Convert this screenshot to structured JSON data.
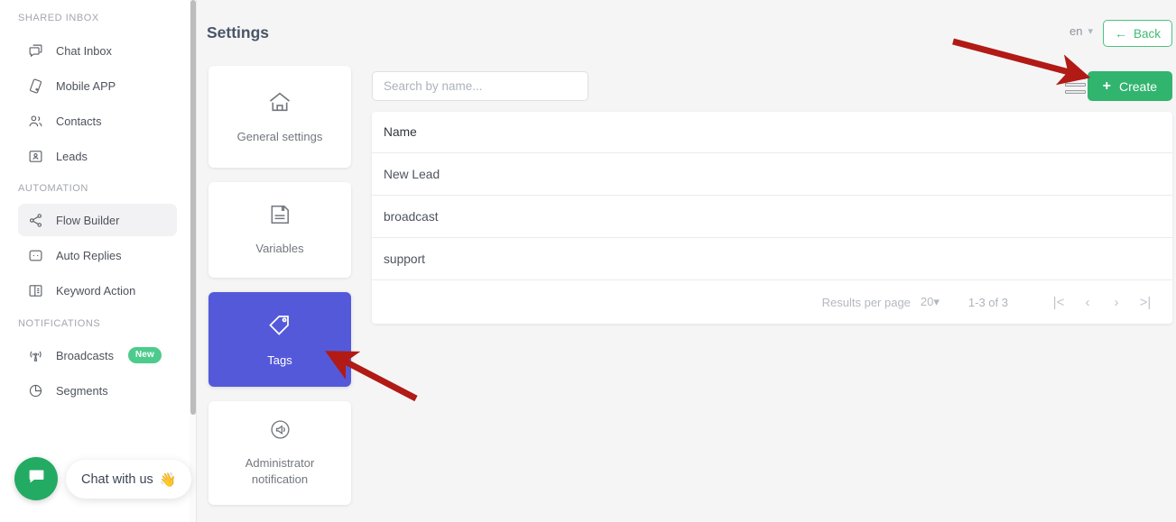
{
  "sidebar": {
    "sections": [
      {
        "title": "SHARED INBOX"
      },
      {
        "title": "AUTOMATION"
      },
      {
        "title": "NOTIFICATIONS"
      }
    ],
    "items": [
      {
        "label": "Chat Inbox",
        "icon": "chat-icon"
      },
      {
        "label": "Mobile APP",
        "icon": "mobile-app-icon"
      },
      {
        "label": "Contacts",
        "icon": "contacts-icon"
      },
      {
        "label": "Leads",
        "icon": "leads-icon"
      },
      {
        "label": "Flow Builder",
        "icon": "flow-builder-icon"
      },
      {
        "label": "Auto Replies",
        "icon": "auto-replies-icon"
      },
      {
        "label": "Keyword Action",
        "icon": "keyword-action-icon"
      },
      {
        "label": "Broadcasts",
        "icon": "broadcasts-icon",
        "badge": "New"
      },
      {
        "label": "Segments",
        "icon": "segments-icon"
      }
    ]
  },
  "chat_widget": {
    "label": "Chat with us",
    "emoji": "👋",
    "launcher_icon": "chat-bubble-icon",
    "color": "#23ab64"
  },
  "header": {
    "title": "Settings",
    "language": "en",
    "language_chevron_icon": "chevron-down-icon",
    "back_label": "Back",
    "back_arrow_icon": "arrow-left-icon",
    "back_color": "#3fbb72"
  },
  "toolbar": {
    "stack_icon": "stack-list-icon",
    "create_label": "Create",
    "create_plus_icon": "plus-icon",
    "create_color": "#31b46e"
  },
  "settings_cards": [
    {
      "label": "General settings",
      "icon": "home-icon",
      "selected": false
    },
    {
      "label": "Variables",
      "icon": "save-disk-icon",
      "selected": false
    },
    {
      "label": "Tags",
      "icon": "tag-icon",
      "selected": true
    },
    {
      "label": "Administrator notification",
      "icon": "megaphone-icon",
      "selected": false
    }
  ],
  "selected_card_color": "#5459da",
  "search": {
    "placeholder": "Search by name...",
    "value": "",
    "icon": "search-input"
  },
  "table": {
    "columns": [
      "Name"
    ],
    "rows": [
      {
        "name": "New Lead"
      },
      {
        "name": "broadcast"
      },
      {
        "name": "support"
      }
    ]
  },
  "pagination": {
    "results_per_page_label": "Results per page",
    "results_per_page_value": "20",
    "results_per_page_chevron": "caret-down-icon",
    "range": "1-3 of 3",
    "first_icon": "|<",
    "prev_icon": "‹",
    "next_icon": "›",
    "last_icon": ">|"
  },
  "annotations": [
    {
      "name": "arrow-to-create-button",
      "color": "#b11a15"
    },
    {
      "name": "arrow-to-tags-card",
      "color": "#b11a15"
    }
  ]
}
